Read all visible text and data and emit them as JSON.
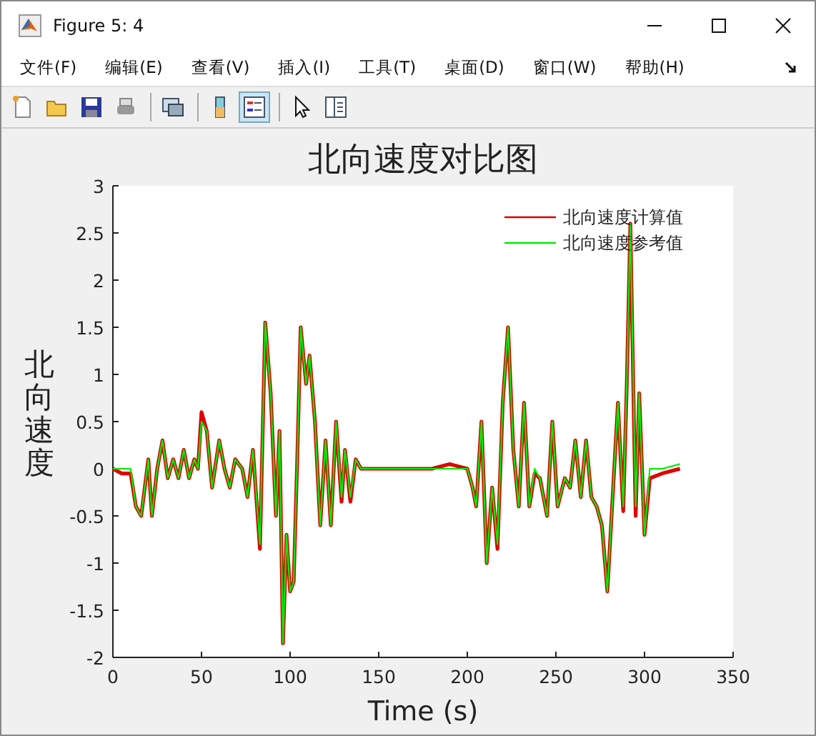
{
  "window": {
    "title": "Figure 5: 4"
  },
  "menu": [
    {
      "label": "文件(F)"
    },
    {
      "label": "编辑(E)"
    },
    {
      "label": "查看(V)"
    },
    {
      "label": "插入(I)"
    },
    {
      "label": "工具(T)"
    },
    {
      "label": "桌面(D)"
    },
    {
      "label": "窗口(W)"
    },
    {
      "label": "帮助(H)"
    }
  ],
  "toolbar": [
    [
      {
        "selected": false
      },
      {
        "selected": false
      },
      {
        "selected": false
      },
      {
        "selected": false
      }
    ],
    [
      {
        "selected": false
      }
    ],
    [
      {
        "selected": false
      },
      {
        "selected": true
      }
    ],
    [
      {
        "selected": false
      },
      {
        "selected": false
      }
    ]
  ],
  "figure": {
    "chart_data": {
      "type": "line",
      "title": "北向速度对比图",
      "xlabel": "Time (s)",
      "ylabel": "北向速度",
      "x": [
        0,
        5,
        10,
        13,
        16,
        20,
        22,
        25,
        28,
        31,
        34,
        37,
        40,
        43,
        46,
        48,
        50,
        53,
        56,
        60,
        63,
        66,
        69,
        73,
        76,
        79,
        83,
        86,
        89,
        92,
        94,
        96,
        98,
        100,
        102,
        104,
        106,
        109,
        111,
        114,
        117,
        120,
        123,
        126,
        129,
        131,
        134,
        137,
        140,
        150,
        160,
        170,
        180,
        190,
        200,
        203,
        205,
        208,
        211,
        214,
        217,
        220,
        223,
        226,
        229,
        232,
        235,
        238,
        241,
        245,
        248,
        251,
        255,
        258,
        261,
        264,
        267,
        270,
        273,
        276,
        279,
        282,
        285,
        288,
        290,
        292,
        295,
        297,
        300,
        303,
        310,
        320
      ],
      "legend": true,
      "xlim": [
        0,
        350
      ],
      "ylim": [
        -2,
        3
      ],
      "xticks": [
        0,
        50,
        100,
        150,
        200,
        250,
        300,
        350
      ],
      "yticks": [
        -2,
        -1.5,
        -1,
        -0.5,
        0,
        0.5,
        1,
        1.5,
        2,
        2.5,
        3
      ],
      "series": [
        {
          "name": "北向速度计算值",
          "color": "#e00000",
          "values": [
            0,
            -0.05,
            -0.05,
            -0.4,
            -0.5,
            0.1,
            -0.5,
            0,
            0.3,
            -0.1,
            0.1,
            -0.1,
            0.2,
            -0.1,
            0.1,
            0,
            0.6,
            0.4,
            -0.2,
            0.3,
            0,
            -0.2,
            0.1,
            0,
            -0.3,
            0.2,
            -0.85,
            1.55,
            0.8,
            -0.5,
            0.4,
            -1.85,
            -0.7,
            -1.3,
            -1.2,
            0.1,
            1.5,
            0.9,
            1.2,
            0.5,
            -0.6,
            0.3,
            -0.6,
            0.5,
            -0.35,
            0.2,
            -0.35,
            0.1,
            0,
            0,
            0,
            0,
            0,
            0.05,
            0,
            -0.2,
            -0.4,
            0.5,
            -1,
            -0.2,
            -0.85,
            0.7,
            1.5,
            0.2,
            -0.4,
            0.7,
            -0.4,
            -0.05,
            -0.1,
            -0.5,
            0.5,
            -0.4,
            -0.1,
            -0.2,
            0.3,
            -0.3,
            0.3,
            -0.3,
            -0.4,
            -0.6,
            -1.3,
            -0.3,
            0.7,
            -0.45,
            0.9,
            2.6,
            -0.5,
            0.8,
            -0.7,
            -0.1,
            -0.05,
            0
          ]
        },
        {
          "name": "北向速度参考值",
          "color": "#00ee00",
          "values": [
            0,
            0,
            0,
            -0.4,
            -0.5,
            0.1,
            -0.5,
            0,
            0.3,
            -0.1,
            0.1,
            -0.1,
            0.2,
            -0.1,
            0.1,
            0,
            0.5,
            0.4,
            -0.2,
            0.3,
            0,
            -0.2,
            0.1,
            0,
            -0.3,
            0.2,
            -0.8,
            1.55,
            0.8,
            -0.5,
            0.4,
            -1.85,
            -0.7,
            -1.3,
            -1.2,
            0.1,
            1.5,
            0.9,
            1.2,
            0.5,
            -0.6,
            0.3,
            -0.6,
            0.5,
            -0.3,
            0.2,
            -0.3,
            0.1,
            0,
            0,
            0,
            0,
            0,
            0,
            0,
            -0.2,
            -0.4,
            0.5,
            -1,
            -0.2,
            -0.8,
            0.7,
            1.5,
            0.2,
            -0.4,
            0.7,
            -0.4,
            0,
            -0.1,
            -0.5,
            0.5,
            -0.4,
            -0.1,
            -0.2,
            0.3,
            -0.3,
            0.3,
            -0.3,
            -0.4,
            -0.6,
            -1.3,
            -0.3,
            0.7,
            -0.4,
            0.9,
            2.6,
            -0.4,
            0.8,
            -0.7,
            0,
            0,
            0.05
          ]
        }
      ]
    }
  }
}
